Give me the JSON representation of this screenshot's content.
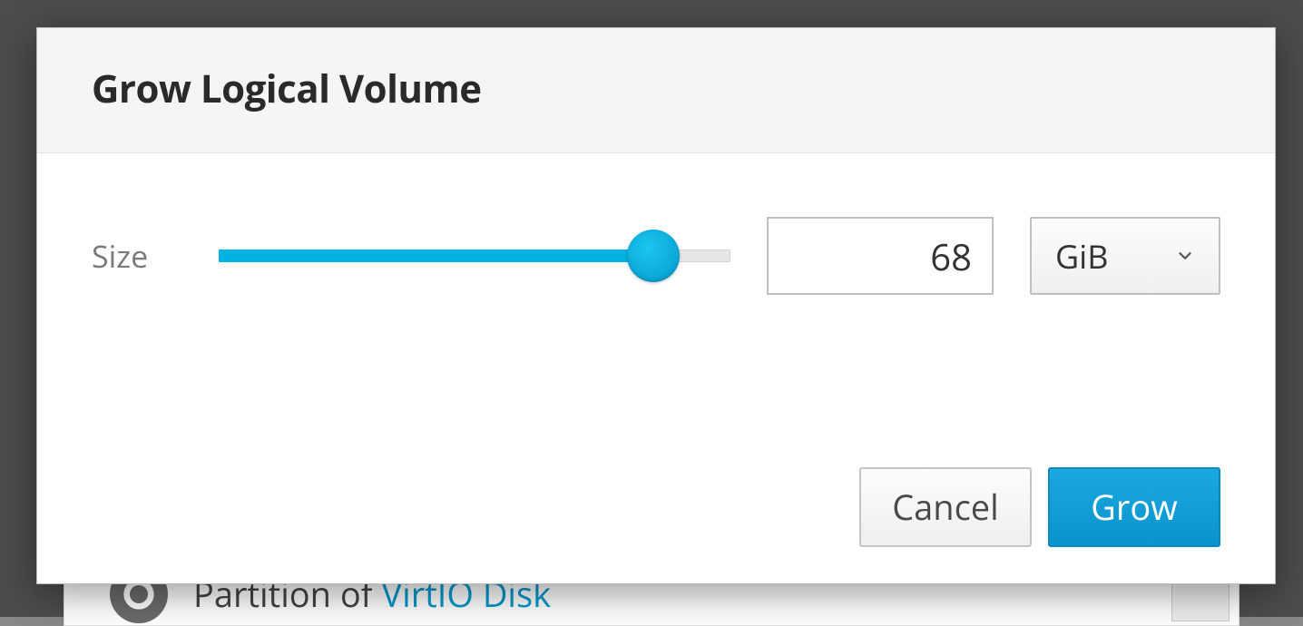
{
  "modal": {
    "title": "Grow Logical Volume",
    "size_label": "Size",
    "size_value": "68",
    "unit_selected": "GiB",
    "slider_percent": 85
  },
  "buttons": {
    "cancel": "Cancel",
    "grow": "Grow"
  },
  "background": {
    "row_text_prefix": "Partition of",
    "row_link": "VirtIO Disk"
  }
}
